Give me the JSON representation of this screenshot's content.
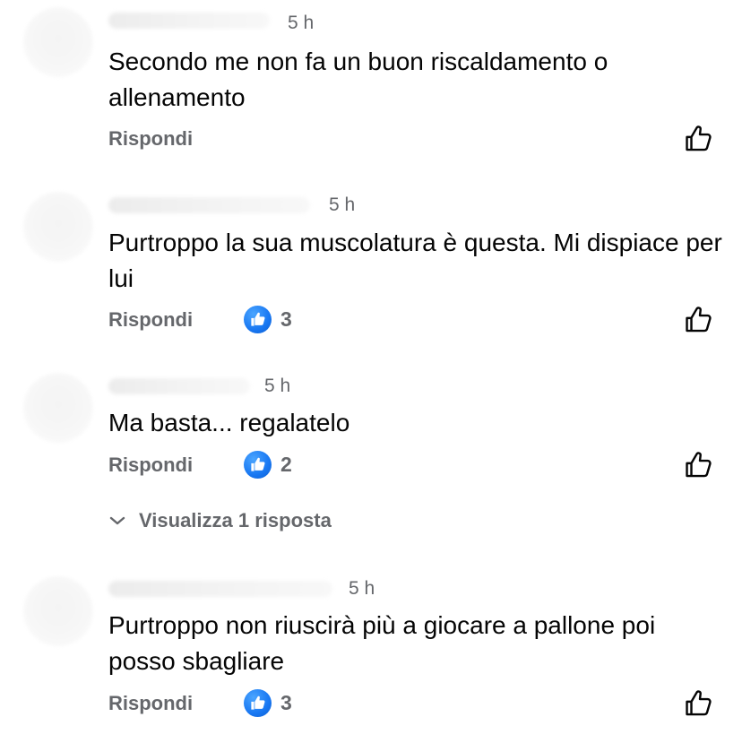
{
  "comments": [
    {
      "time": "5 h",
      "text": "Secondo me non fa un buon riscaldamento o allenamento",
      "reply_label": "Rispondi",
      "reaction_count": null
    },
    {
      "time": "5 h",
      "text": "Purtroppo la sua muscolatura è questa. Mi dispiace per lui",
      "reply_label": "Rispondi",
      "reaction_count": "3"
    },
    {
      "time": "5 h",
      "text": "Ma basta... regalatelo",
      "reply_label": "Rispondi",
      "reaction_count": "2"
    },
    {
      "time": "5 h",
      "text": "Purtroppo non riuscirà più a giocare a pallone poi posso sbagliare",
      "reply_label": "Rispondi",
      "reaction_count": "3"
    }
  ],
  "view_replies": {
    "label": "Visualizza 1 risposta"
  },
  "colors": {
    "accent_blue": "#1877f2",
    "secondary_text": "#65676b",
    "primary_text": "#050505"
  },
  "icons": {
    "like": "thumbs-up-outline-icon",
    "reaction": "like-reaction-icon",
    "expand": "chevron-down-icon"
  }
}
